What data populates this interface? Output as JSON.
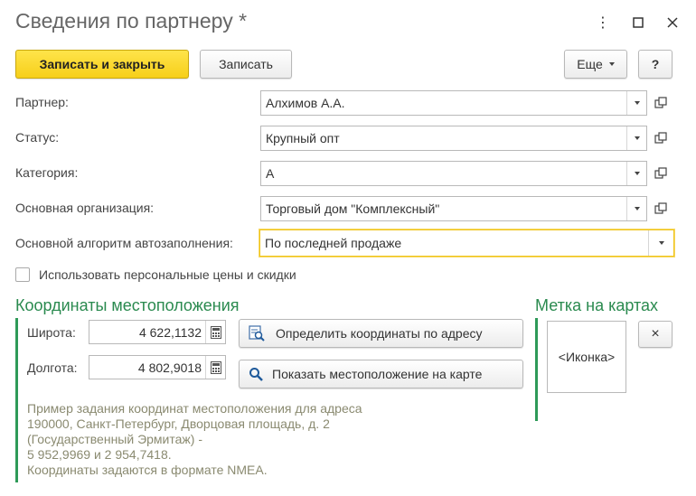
{
  "window": {
    "title": "Сведения по партнеру *"
  },
  "toolbar": {
    "save_close_label": "Записать и закрыть",
    "save_label": "Записать",
    "more_label": "Еще",
    "help_label": "?"
  },
  "fields": {
    "partner": {
      "label": "Партнер:",
      "value": "Алхимов А.А."
    },
    "status": {
      "label": "Статус:",
      "value": "Крупный опт"
    },
    "category": {
      "label": "Категория:",
      "value": "А"
    },
    "organization": {
      "label": "Основная организация:",
      "value": "Торговый дом \"Комплексный\""
    },
    "autofill": {
      "label": "Основной алгоритм автозаполнения:",
      "value": "По последней продаже"
    }
  },
  "personal_prices": {
    "label": "Использовать персональные цены и скидки",
    "checked": false
  },
  "coordinates": {
    "title": "Координаты местоположения",
    "latitude": {
      "label": "Широта:",
      "value": "4 622,1132"
    },
    "longitude": {
      "label": "Долгота:",
      "value": "4 802,9018"
    },
    "find_by_address_label": "Определить координаты по адресу",
    "show_on_map_label": "Показать местоположение на карте",
    "hint_lines": [
      "Пример задания координат местоположения для адреса",
      "190000, Санкт-Петербург, Дворцовая площадь, д. 2",
      "(Государственный Эрмитаж) -",
      "5 952,9969 и 2 954,7418.",
      "Координаты задаются в формате NMEA."
    ]
  },
  "map_marker": {
    "title": "Метка на картах",
    "icon_placeholder": "<Иконка>",
    "clear_label": "×"
  },
  "colors": {
    "accent_green": "#2a8a4f",
    "primary_yellow": "#f6cf1a",
    "focus_border": "#f0c419",
    "hint_text": "#8a8a70"
  }
}
